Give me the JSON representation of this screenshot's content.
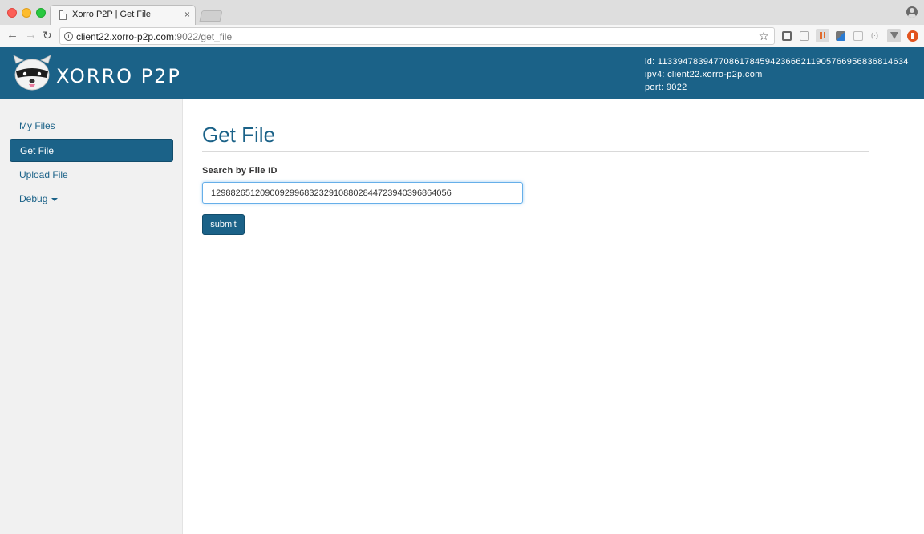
{
  "browser": {
    "tab_title": "Xorro P2P | Get File",
    "tab_close": "×",
    "url_host": "client22.xorro-p2p.com",
    "url_rest": ":9022/get_file",
    "icons": [
      "back-icon",
      "forward-icon",
      "reload-icon",
      "info-icon",
      "star-icon",
      "cast-icon",
      "profile-icon"
    ]
  },
  "header": {
    "brand": "XORRO P2P",
    "node_id": "id: 113394783947708617845942366621190576695683681463​4",
    "ipv4": "ipv4: client22.xorro-p2p.com",
    "port": "port: 9022"
  },
  "sidebar": {
    "items": [
      {
        "label": "My Files"
      },
      {
        "label": "Get File"
      },
      {
        "label": "Upload File"
      },
      {
        "label": "Debug"
      }
    ]
  },
  "main": {
    "title": "Get File",
    "field_label": "Search by File ID",
    "file_id_value": "129882651209009299683232910880284472394039686405​6",
    "submit_label": "submit"
  },
  "colors": {
    "brand_blue": "#1b6288",
    "focus_blue": "#66afe9"
  }
}
